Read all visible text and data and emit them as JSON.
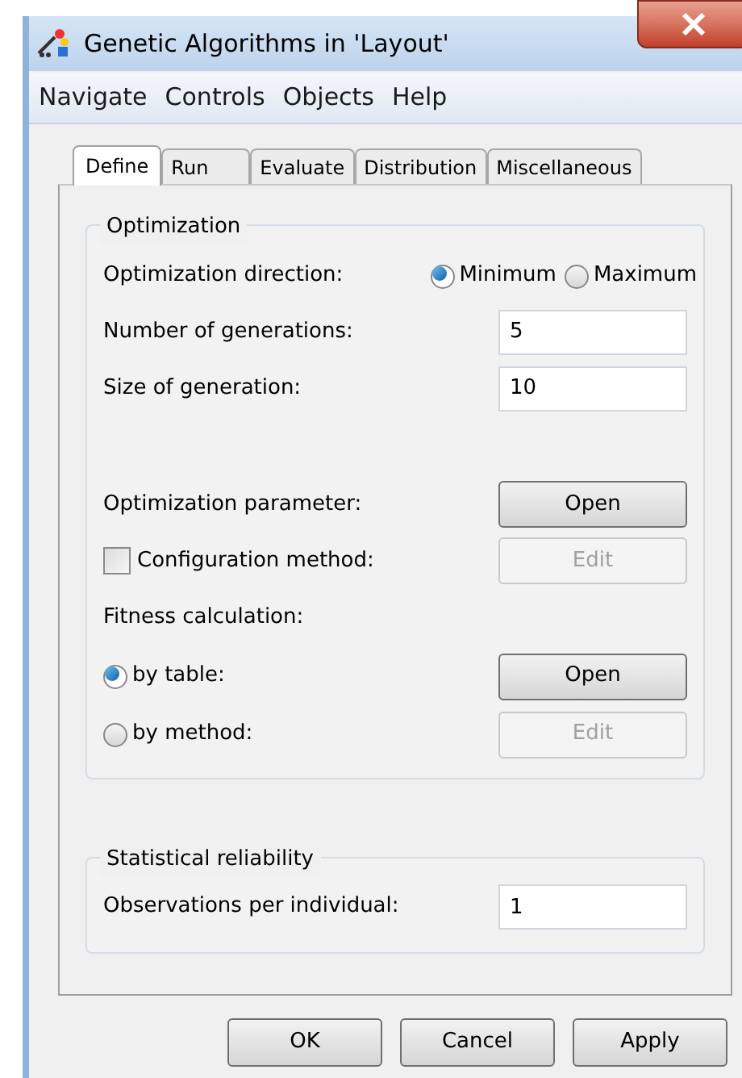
{
  "window": {
    "title": "Genetic Algorithms in 'Layout'"
  },
  "menu": [
    "Navigate",
    "Controls",
    "Objects",
    "Help"
  ],
  "tabs": [
    {
      "label": "Define",
      "selected": true
    },
    {
      "label": "Run",
      "selected": false
    },
    {
      "label": "Evaluate",
      "selected": false
    },
    {
      "label": "Distribution",
      "selected": false
    },
    {
      "label": "Miscellaneous",
      "selected": false
    }
  ],
  "optimization": {
    "title": "Optimization",
    "direction": {
      "label": "Optimization direction:",
      "options": [
        {
          "label": "Minimum",
          "selected": true
        },
        {
          "label": "Maximum",
          "selected": false
        }
      ]
    },
    "generations": {
      "label": "Number of generations:",
      "value": "5"
    },
    "size": {
      "label": "Size of generation:",
      "value": "10"
    },
    "parameter": {
      "label": "Optimization parameter:",
      "button": "Open",
      "disabled": false
    },
    "configuration": {
      "label": "Configuration method:",
      "checked": false,
      "button": "Edit",
      "disabled": true
    },
    "fitness": {
      "label": "Fitness calculation:",
      "options": [
        {
          "label": "by table:",
          "selected": true,
          "button": "Open",
          "disabled": false
        },
        {
          "label": "by method:",
          "selected": false,
          "button": "Edit",
          "disabled": true
        }
      ]
    }
  },
  "reliability": {
    "title": "Statistical reliability",
    "observations": {
      "label": "Observations per individual:",
      "value": "1"
    }
  },
  "buttons": [
    "OK",
    "Cancel",
    "Apply"
  ]
}
